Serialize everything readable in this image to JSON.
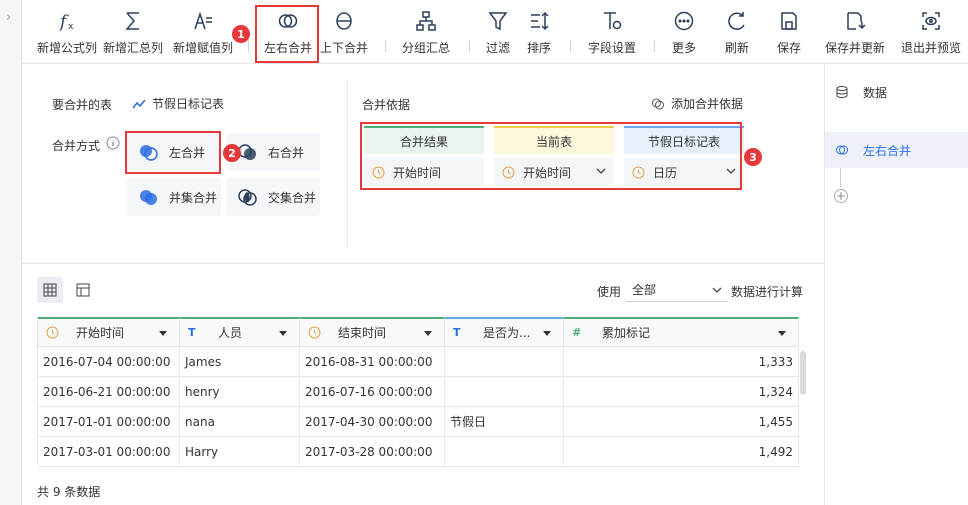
{
  "toolbar": {
    "items": [
      {
        "label": "新增公式列",
        "icon": "formula-icon"
      },
      {
        "label": "新增汇总列",
        "icon": "sigma-icon"
      },
      {
        "label": "新增赋值列",
        "icon": "assign-icon"
      },
      {
        "label": "左右合并",
        "icon": "left-right-merge-icon"
      },
      {
        "label": "上下合并",
        "icon": "up-down-merge-icon"
      },
      {
        "label": "分组汇总",
        "icon": "group-summary-icon"
      },
      {
        "label": "过滤",
        "icon": "filter-icon"
      },
      {
        "label": "排序",
        "icon": "sort-icon"
      },
      {
        "label": "字段设置",
        "icon": "field-settings-icon"
      },
      {
        "label": "更多",
        "icon": "more-icon"
      },
      {
        "label": "刷新",
        "icon": "refresh-icon"
      },
      {
        "label": "保存",
        "icon": "save-icon"
      },
      {
        "label": "保存并更新",
        "icon": "save-update-icon"
      },
      {
        "label": "退出并预览",
        "icon": "exit-preview-icon"
      }
    ]
  },
  "annotations": {
    "b1": "1",
    "b2": "2",
    "b3": "3"
  },
  "settings": {
    "merge_table_label": "要合并的表",
    "merge_table_value": "节假日标记表",
    "merge_method_label": "合并方式",
    "methods": {
      "left": "左合并",
      "right": "右合并",
      "union": "并集合并",
      "intersect": "交集合并"
    },
    "basis_label": "合并依据",
    "add_basis": "添加合并依据",
    "columns": [
      {
        "header": "合并结果",
        "value": "开始时间"
      },
      {
        "header": "当前表",
        "value": "开始时间"
      },
      {
        "header": "节假日标记表",
        "value": "日历"
      }
    ]
  },
  "right_panel": {
    "data": "数据",
    "merge": "左右合并"
  },
  "calc": {
    "use": "使用",
    "selected": "全部",
    "suffix": "数据进行计算"
  },
  "table": {
    "headers": [
      "开始时间",
      "人员",
      "结束时间",
      "是否为...",
      "累加标记"
    ],
    "rows": [
      [
        "2016-07-04 00:00:00",
        "James",
        "2016-08-31 00:00:00",
        "",
        "1,333"
      ],
      [
        "2016-06-21 00:00:00",
        "henry",
        "2016-07-16 00:00:00",
        "",
        "1,324"
      ],
      [
        "2017-01-01 00:00:00",
        "nana",
        "2017-04-30 00:00:00",
        "节假日",
        "1,455"
      ],
      [
        "2017-03-01 00:00:00",
        "Harry",
        "2017-03-28 00:00:00",
        "",
        "1,492"
      ]
    ],
    "footer": "共 9 条数据"
  },
  "colors": {
    "accent": "#2b6ce6",
    "highlight": "#e5383b",
    "green": "#4caf7a",
    "yellow": "#f0c84a",
    "blue": "#6aa8ea"
  }
}
